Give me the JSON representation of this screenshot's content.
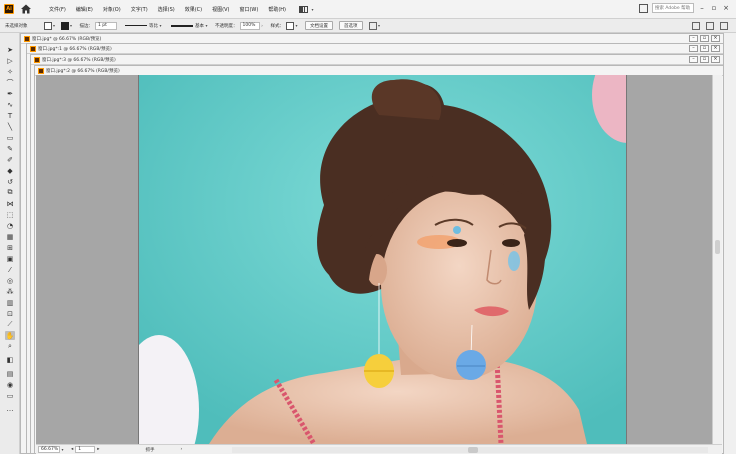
{
  "app": {
    "logo_text": "Ai"
  },
  "menu": [
    "文件(F)",
    "编辑(E)",
    "对象(O)",
    "文字(T)",
    "选择(S)",
    "效果(C)",
    "视图(V)",
    "窗口(W)",
    "帮助(H)"
  ],
  "search": {
    "placeholder": "搜索 Adobe 帮助"
  },
  "control_bar": {
    "selection_label": "未选择对象",
    "stroke_label": "描边：",
    "stroke_value": "1 pt",
    "profile_label": "等比",
    "brush_label": "基本",
    "opacity_label": "不透明度：",
    "opacity_value": "100%",
    "style_label": "样式：",
    "doc_setup_button": "文档设置",
    "prefs_button": "首选项"
  },
  "documents": [
    {
      "title": "窗口.jpg* @ 66.67% (RGB/预览)"
    },
    {
      "title": "窗口.jpg*:1 @ 66.67% (RGB/预览)"
    },
    {
      "title": "窗口.jpg*:3 @ 66.67% (RGB/预览)"
    },
    {
      "title": "窗口.jpg*:2 @ 66.67% (RGB/预览)"
    }
  ],
  "status": {
    "zoom": "66.67%",
    "artboard_number": "1",
    "tool_name": "抓手"
  },
  "colors": {
    "canvas_bg": "#a6a6a6",
    "artboard_bg": "#5fc9c6",
    "accent": "#ff9a00"
  },
  "tools": [
    "selection-tool",
    "direct-selection-tool",
    "magic-wand-tool",
    "lasso-tool",
    "pen-tool",
    "curvature-tool",
    "type-tool",
    "line-tool",
    "rectangle-tool",
    "paintbrush-tool",
    "shaper-tool",
    "eraser-tool",
    "rotate-tool",
    "scale-tool",
    "width-tool",
    "free-transform-tool",
    "shape-builder-tool",
    "perspective-tool",
    "mesh-tool",
    "gradient-tool",
    "eyedropper-tool",
    "blend-tool",
    "symbol-sprayer-tool",
    "column-graph-tool",
    "artboard-tool",
    "slice-tool",
    "hand-tool",
    "zoom-tool",
    "fill-stroke-swatch",
    "swap-icon",
    "drawing-mode",
    "screen-mode",
    "edit-toolbar"
  ]
}
